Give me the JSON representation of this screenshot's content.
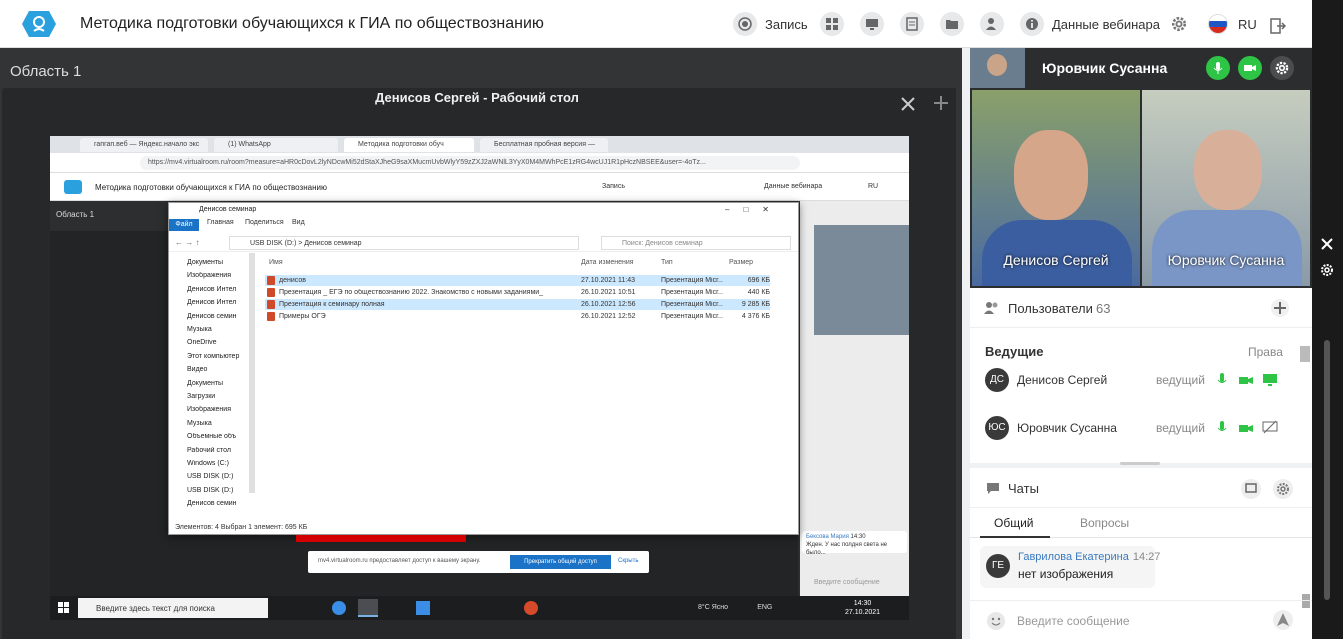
{
  "header": {
    "title": "Методика подготовки обучающихся к ГИА по обществознанию",
    "record_label": "Запись",
    "webinar_data_label": "Данные вебинара",
    "lang": "RU"
  },
  "stage": {
    "area_title": "Область 1",
    "panel_title": "Денисов Сергей - Рабочий стол"
  },
  "browser": {
    "tabs": [
      "гапгап.веб — Яндекс.начало экс",
      "(1) WhatsApp",
      "Методика подготовки обуч",
      "Бесплатная пробная версия —"
    ],
    "url": "https://mv4.virtualroom.ru/room?measure=aHR0cDovL2lyNDcwMi52dStaXJheG9saXMucmUvbWlyY59zZXJ2aWNlL3YyX0M4MWhPcE1zRG4wcUJ1R1pHczNBSEE&user=-4oTz...",
    "inner_title": "Методика подготовки обучающихся к ГИА по обществознанию",
    "inner_record": "Запись",
    "inner_webinar": "Данные вебинара",
    "inner_lang": "RU",
    "inner_area": "Область 1"
  },
  "explorer": {
    "title": "Денисов семинар",
    "ribbon": [
      "Файл",
      "Главная",
      "Поделиться",
      "Вид"
    ],
    "path": "USB DISK (D:) > Денисов семинар",
    "search_placeholder": "Поиск: Денисов семинар",
    "sidebar": [
      "Документы",
      "Изображения",
      "Денисов Интел",
      "Денисов Интел",
      "Денисов семин",
      "Музыка",
      "OneDrive",
      "Этот компьютер",
      "Видео",
      "Документы",
      "Загрузки",
      "Изображения",
      "Музыка",
      "Объемные объ",
      "Рабочий стол",
      "Windows (C:)",
      "USB DISK (D:)",
      "USB DISK (D:)",
      "Денисов семин"
    ],
    "columns": [
      "Имя",
      "Дата изменения",
      "Тип",
      "Размер"
    ],
    "files": [
      {
        "name": "денисов",
        "date": "27.10.2021 11:43",
        "type": "Презентация Micr...",
        "size": "696 КБ",
        "selected": true
      },
      {
        "name": "Презентация _ ЕГЭ по обществознанию 2022. Знакомство с новыми заданиями_",
        "date": "26.10.2021 10:51",
        "type": "Презентация Micr...",
        "size": "440 КБ",
        "selected": false
      },
      {
        "name": "Презентация к семинару полная",
        "date": "26.10.2021 12:56",
        "type": "Презентация Micr...",
        "size": "9 285 КБ",
        "selected": true
      },
      {
        "name": "Примеры ОГЭ",
        "date": "26.10.2021 12:52",
        "type": "Презентация Micr...",
        "size": "4 376 КБ",
        "selected": false
      }
    ],
    "status": "Элементов: 4    Выбран 1 элемент: 695 КБ"
  },
  "sharebar": {
    "text": "mv4.virtualroom.ru предоставляет доступ к вашему экрану.",
    "stop_label": "Прекратить общий доступ",
    "hide_label": "Скрыть"
  },
  "inner_chat": {
    "author": "Бексова Мария",
    "time": "14:30",
    "text": "Жден. У нас полдня света не было...",
    "placeholder": "Введите сообщение"
  },
  "taskbar": {
    "search": "Введите здесь текст для поиска",
    "weather": "8°C Ясно",
    "lang": "ENG",
    "time": "14:30",
    "date": "27.10.2021"
  },
  "right": {
    "host_name": "Юровчик Сусанна",
    "videos": [
      {
        "name": "Денисов Сергей"
      },
      {
        "name": "Юровчик Сусанна"
      }
    ],
    "users_title": "Пользователи",
    "users_count": "63",
    "hosts_label": "Ведущие",
    "rights_label": "Права",
    "hosts": [
      {
        "initials": "ДС",
        "name": "Денисов Сергей",
        "role": "ведущий"
      },
      {
        "initials": "ЮС",
        "name": "Юровчик Сусанна",
        "role": "ведущий"
      }
    ],
    "chats_title": "Чаты",
    "chat_tabs": [
      "Общий",
      "Вопросы"
    ],
    "message": {
      "initials": "ГЕ",
      "author": "Гаврилова Екатерина",
      "time": "14:27",
      "text": "нет изображения"
    },
    "input_placeholder": "Введите сообщение"
  },
  "colors": {
    "accent": "#1a73c7",
    "green": "#2ec445",
    "dark": "#2b2d2f"
  }
}
